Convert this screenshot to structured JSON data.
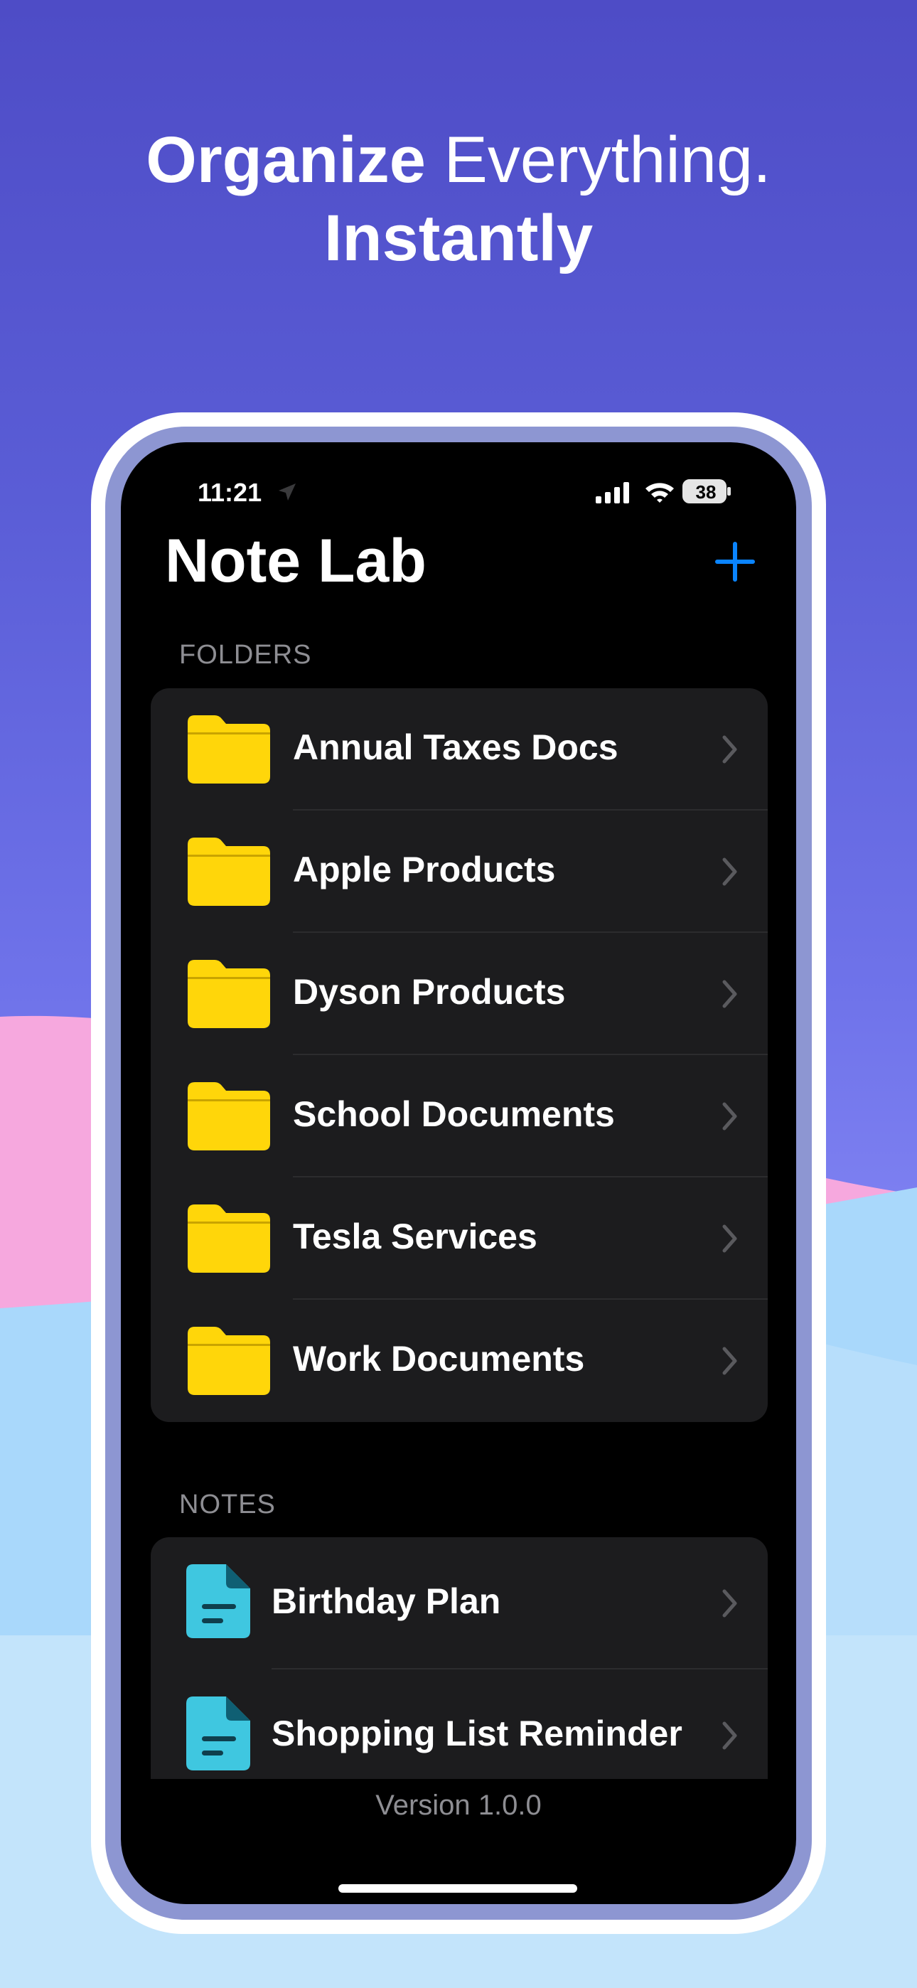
{
  "headline": {
    "word1": "Organize",
    "word2": " Everything.",
    "word3": "Instantly"
  },
  "status_bar": {
    "time": "11:21",
    "battery": "38"
  },
  "app": {
    "title": "Note Lab"
  },
  "folders": {
    "header": "FOLDERS",
    "items": [
      {
        "label": "Annual Taxes Docs"
      },
      {
        "label": "Apple Products"
      },
      {
        "label": "Dyson Products"
      },
      {
        "label": "School Documents"
      },
      {
        "label": "Tesla Services"
      },
      {
        "label": "Work Documents"
      }
    ]
  },
  "notes": {
    "header": "NOTES",
    "items": [
      {
        "label": "Birthday Plan"
      },
      {
        "label": "Shopping List Reminder"
      }
    ]
  },
  "footer": {
    "version": "Version 1.0.0"
  },
  "colors": {
    "accent": "#0a84ff",
    "folder": "#ffd60a",
    "note": "#3fc7e0"
  }
}
